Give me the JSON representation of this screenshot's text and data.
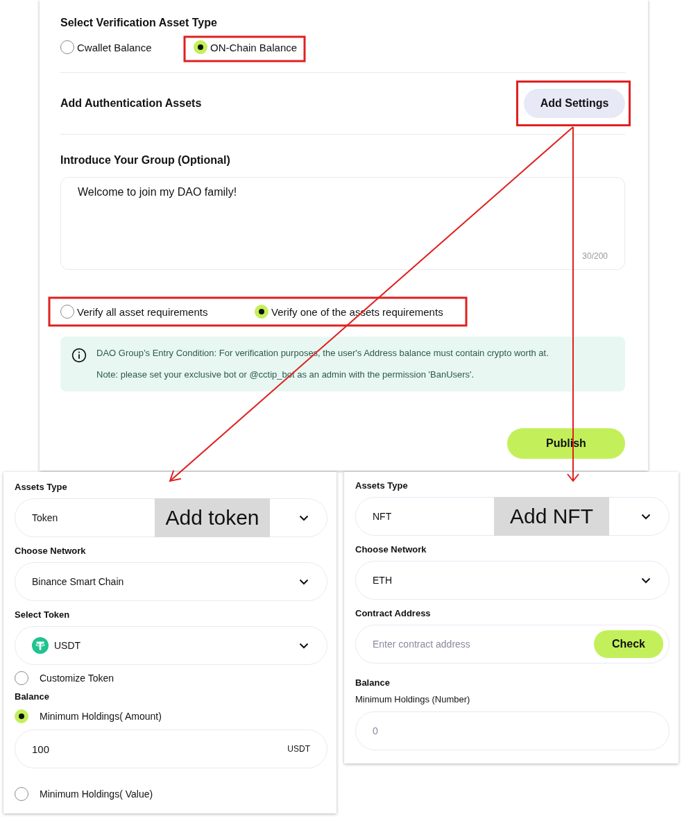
{
  "asset_type": {
    "title": "Select Verification Asset Type",
    "options": [
      {
        "label": "Cwallet Balance",
        "selected": false
      },
      {
        "label": "ON-Chain Balance",
        "selected": true
      }
    ]
  },
  "auth_assets": {
    "title": "Add Authentication Assets",
    "button": "Add Settings"
  },
  "intro": {
    "title": "Introduce Your Group (Optional)",
    "value": "Welcome to join my DAO family!",
    "counter": "30/200"
  },
  "verify_mode": [
    {
      "label": "Verify all asset requirements",
      "selected": false
    },
    {
      "label": "Verify one of the assets requirements",
      "selected": true
    }
  ],
  "notice": [
    "DAO Group’s Entry Condition: For verification purposes, the user's Address balance must contain crypto worth at.",
    "Note: please set your exclusive bot or @cctip_bot as an admin with the permission 'BanUsers'."
  ],
  "publish": "Publish",
  "panels": [
    {
      "rows": [
        {
          "kind": "select",
          "label": "Assets Type",
          "value": "Token",
          "caption": "Add token"
        },
        {
          "kind": "select",
          "label": "Choose Network",
          "value": "Binance Smart Chain"
        },
        {
          "kind": "token_select",
          "label": "Select Token",
          "value": "USDT"
        },
        {
          "kind": "radio",
          "label": "Customize Token",
          "selected": false
        },
        {
          "kind": "heading",
          "label": "Balance"
        },
        {
          "kind": "radio",
          "label": "Minimum Holdings( Amount)",
          "selected": true
        },
        {
          "kind": "input",
          "value": "100",
          "suffix": "USDT"
        },
        {
          "kind": "radio",
          "label": "Minimum Holdings( Value)",
          "selected": false
        }
      ]
    },
    {
      "rows": [
        {
          "kind": "select",
          "label": "Assets Type",
          "value": "NFT",
          "caption": "Add NFT"
        },
        {
          "kind": "select",
          "label": "Choose Network",
          "value": "ETH"
        },
        {
          "kind": "check_input",
          "label": "Contract Address",
          "placeholder": "Enter contract address",
          "button": "Check"
        },
        {
          "kind": "heading",
          "label": "Balance"
        },
        {
          "kind": "subheading",
          "label": "Minimum Holdings (Number)"
        },
        {
          "kind": "input",
          "placeholder": "0"
        }
      ]
    }
  ]
}
